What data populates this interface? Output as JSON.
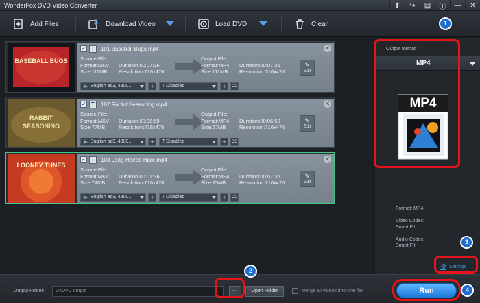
{
  "window": {
    "title": "WonderFox DVD Video Converter"
  },
  "toolbar": {
    "add_files": "Add Files",
    "download_video": "Download Video",
    "load_dvd": "Load DVD",
    "clear": "Clear"
  },
  "items": [
    {
      "index": "101",
      "filename": "101 Baseball Bugs.mp4",
      "source_label": "Source File:",
      "source_format": "Format:MKV",
      "source_duration": "Duration:00:07:36",
      "source_size": "Size:111MB",
      "source_resolution": "Resolution:716x476",
      "output_label": "Output File:",
      "output_format": "Format:MP4",
      "output_duration": "Duration:00:07:36",
      "output_size": "Size:111MB",
      "output_resolution": "Resolution:716x476",
      "audio": "English ac3, 4800...",
      "subtitle": "Disabled",
      "thumb_text": "BASEBALL BUGS"
    },
    {
      "index": "102",
      "filename": "102 Rabbit Seasoning.mp4",
      "source_label": "Source File:",
      "source_format": "Format:MKV",
      "source_duration": "Duration:00:06:50",
      "source_size": "Size:77MB",
      "source_resolution": "Resolution:716x476",
      "output_label": "Output File:",
      "output_format": "Format:MP4",
      "output_duration": "Duration:00:06:50",
      "output_size": "Size:67MB",
      "output_resolution": "Resolution:716x476",
      "audio": "English ac3, 4800...",
      "subtitle": "Disabled",
      "thumb_text": "RABBIT SEASONING"
    },
    {
      "index": "103",
      "filename": "103 Long-Haired Hare.mp4",
      "source_label": "Source File:",
      "source_format": "Format:MKV",
      "source_duration": "Duration:00:07:36",
      "source_size": "Size:74MB",
      "source_resolution": "Resolution:716x476",
      "output_label": "Output File:",
      "output_format": "Format:MP4",
      "output_duration": "Duration:00:07:36",
      "output_size": "Size:75MB",
      "output_resolution": "Resolution:716x476",
      "audio": "English ac3, 4800...",
      "subtitle": "Disabled",
      "thumb_text": "LOONEY TUNES"
    }
  ],
  "edit_label": "Edit",
  "cc_label": "CC",
  "format_panel": {
    "label": "Output format:",
    "selected": "MP4",
    "icon_text": "MP4",
    "info_format": "Format: MP4",
    "video_codec_label": "Video Codec:",
    "video_codec_value": "Smart Fit",
    "audio_codec_label": "Audio Codec:",
    "audio_codec_value": "Smart Fit",
    "settings": "Settings"
  },
  "bottom": {
    "output_folder_label": "Output Folder:",
    "output_folder_value": "D:\\DVC output",
    "browse": "···",
    "open_folder": "Open Folder",
    "merge": "Merge all videos into one file.",
    "run": "Run"
  },
  "badges": [
    "1",
    "2",
    "3",
    "4"
  ],
  "colors": {
    "callout": "#e8141b",
    "badge": "#1f6fd1",
    "accent": "#3d92e6",
    "selected_border": "#44c58b"
  }
}
